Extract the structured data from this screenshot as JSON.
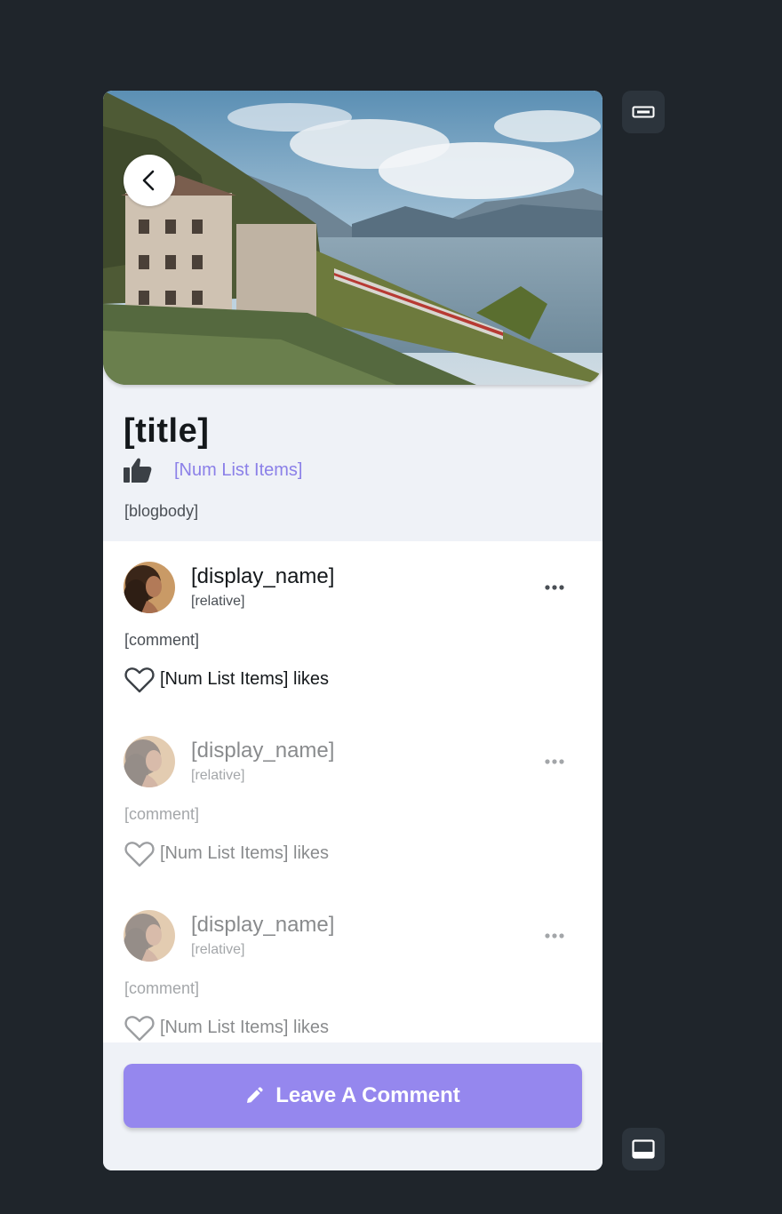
{
  "post": {
    "title": "[title]",
    "likes_count": "[Num List Items]",
    "body": "[blogbody]"
  },
  "comments": [
    {
      "display_name": "[display_name]",
      "relative": "[relative]",
      "comment": "[comment]",
      "likes": "[Num List Items]",
      "likes_suffix": "likes"
    },
    {
      "display_name": "[display_name]",
      "relative": "[relative]",
      "comment": "[comment]",
      "likes": "[Num List Items]",
      "likes_suffix": "likes"
    },
    {
      "display_name": "[display_name]",
      "relative": "[relative]",
      "comment": "[comment]",
      "likes": "[Num List Items]",
      "likes_suffix": "likes"
    }
  ],
  "cta": {
    "label": "Leave A Comment"
  },
  "icons": {
    "back": "chevron-left-icon",
    "thumbs_up": "thumbs-up-icon",
    "more": "more-horizontal-icon",
    "like": "heart-outline-icon",
    "edit": "pencil-icon",
    "side_top": "keyboard-icon",
    "side_bottom": "bottom-panel-icon"
  },
  "colors": {
    "accent": "#9587ee",
    "likes_text": "#8b80e8",
    "page_bg": "#1f252b",
    "card_bg": "#eff2f7"
  }
}
